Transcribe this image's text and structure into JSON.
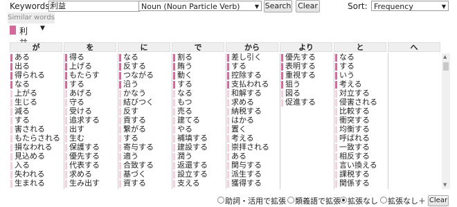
{
  "search": {
    "keywords_label": "Keywords:",
    "keyword_value": "利益",
    "pos_filter": "Noun (Noun Particle Verb)",
    "search_button": "Search",
    "clear_button": "Clear",
    "sort_label": "Sort:",
    "sort_value": "Frequency"
  },
  "similar_words_button": "Similar words",
  "term": {
    "label": "利益",
    "swatch_color": "#d46a9b"
  },
  "columns": [
    {
      "header": "が",
      "items": [
        "ある",
        "出る",
        "得られる",
        "なる",
        "上がる",
        "生じる",
        "減る",
        "する",
        "害される",
        "もたらされる",
        "損なわれる",
        "見込める",
        "入る",
        "失われる",
        "生まれる"
      ]
    },
    {
      "header": "を",
      "items": [
        "得る",
        "上げる",
        "もたらす",
        "する",
        "あげる",
        "守る",
        "受ける",
        "追求する",
        "出す",
        "生む",
        "保護する",
        "優先する",
        "代表する",
        "求める",
        "生み出す"
      ]
    },
    {
      "header": "に",
      "items": [
        "なる",
        "反する",
        "つながる",
        "沿う",
        "かなう",
        "結びつく",
        "反す",
        "貢する",
        "繋がる",
        "する",
        "寄与する",
        "適う",
        "合致する",
        "基づく",
        "資する"
      ]
    },
    {
      "header": "で",
      "items": [
        "割る",
        "賄う",
        "動く",
        "する",
        "なる",
        "もつ",
        "売る",
        "建てる",
        "やる",
        "補填する",
        "建設する",
        "潤う",
        "返還する",
        "設立する",
        "支える"
      ]
    },
    {
      "header": "から",
      "items": [
        "差し引く",
        "する",
        "控除する",
        "支払われる",
        "和解する",
        "求める",
        "納税する",
        "はかる",
        "置く",
        "考える",
        "崇拝される",
        "ある",
        "関与する",
        "派生する",
        "獲得する"
      ]
    },
    {
      "header": "より",
      "items": [
        "優先する",
        "表明する",
        "重視する",
        "狙う",
        "図る",
        "促進する"
      ]
    },
    {
      "header": "と",
      "items": [
        "なる",
        "する",
        "いう",
        "考える",
        "対立する",
        "侵害される",
        "比較する",
        "衝突する",
        "均衡する",
        "呼ばれる",
        "一致する",
        "相反する",
        "言い換える",
        "課税する",
        "関係する"
      ]
    },
    {
      "header": "へ",
      "items": []
    }
  ],
  "bar_colors": {
    "strong": "#d46a9b",
    "light": "#f3cfe0"
  },
  "options": {
    "radio1": "助詞・活用で拡張",
    "radio2": "類義語で拡張",
    "radio3": "拡張なし",
    "radio4": "拡張なし＋",
    "selected": "拡張なし",
    "clear_button": "Clear"
  }
}
